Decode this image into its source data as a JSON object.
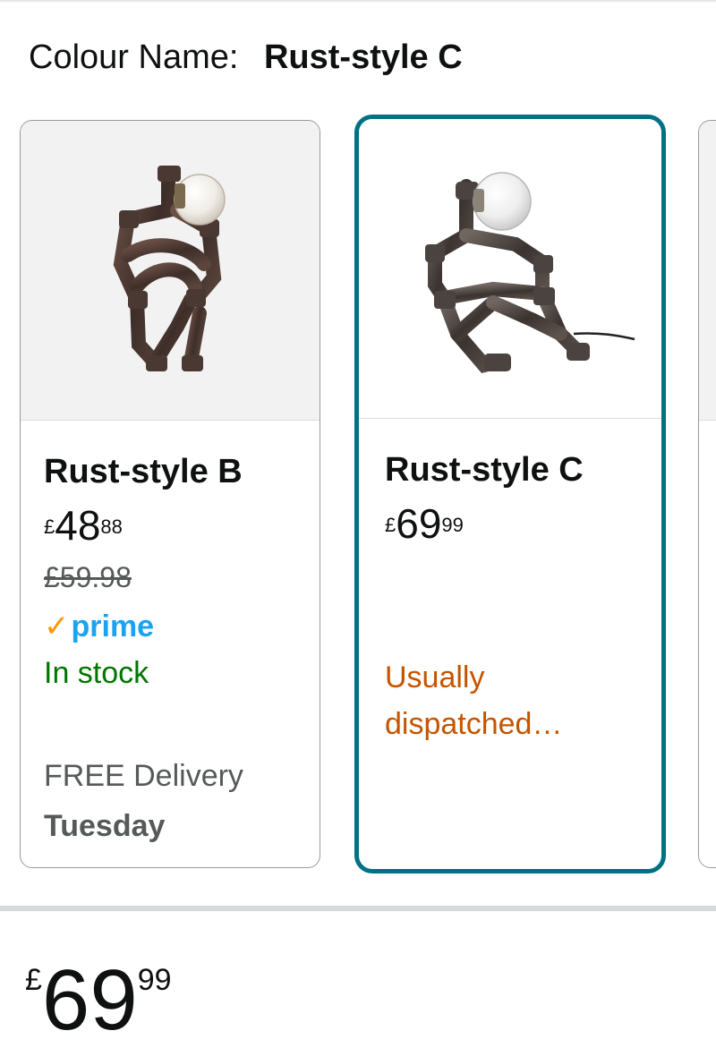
{
  "colour": {
    "label": "Colour Name:",
    "value": "Rust-style C"
  },
  "variants": [
    {
      "title": "Rust-style B",
      "price_symbol": "£",
      "price_whole": "48",
      "price_fraction": "88",
      "was_price": "£59.98",
      "prime_check": "✓",
      "prime_label": "prime",
      "stock": "In stock",
      "delivery_label": "FREE Delivery",
      "delivery_day": "Tuesday",
      "selected": false
    },
    {
      "title": "Rust-style C",
      "price_symbol": "£",
      "price_whole": "69",
      "price_fraction": "99",
      "dispatch": "Usually dispatched…",
      "selected": true
    }
  ],
  "main_price": {
    "symbol": "£",
    "whole": "69",
    "fraction": "99"
  },
  "colors": {
    "selected_border": "#007185",
    "in_stock": "#007600",
    "dispatch": "#c45500",
    "prime_blue": "#1aa3f0",
    "prime_check": "#ff9900"
  }
}
